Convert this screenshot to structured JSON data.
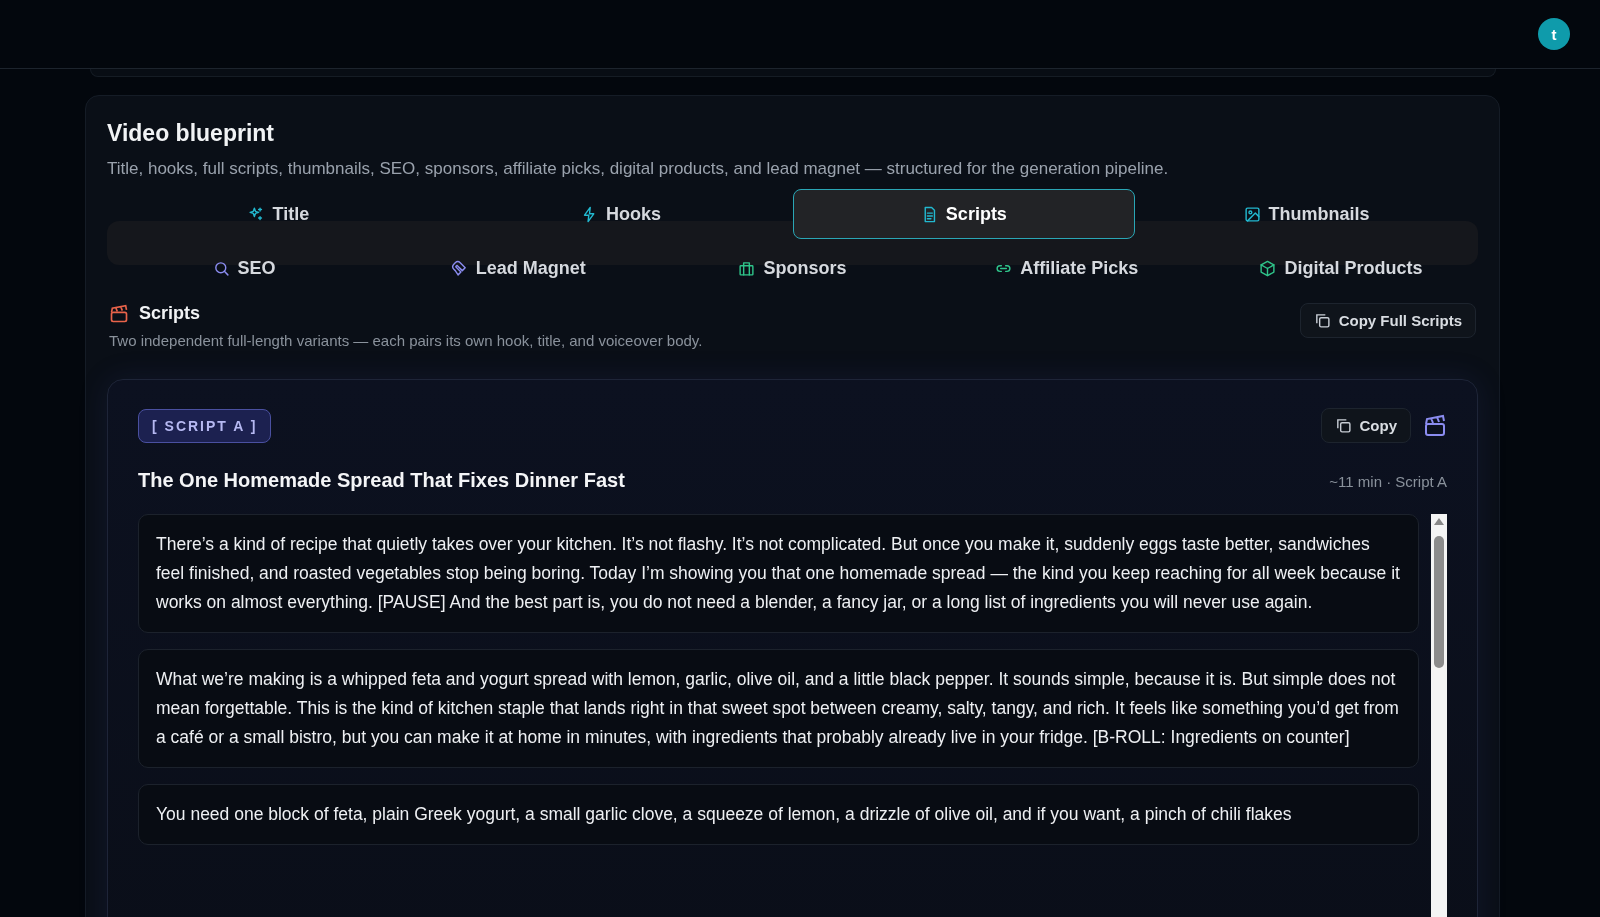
{
  "header": {
    "avatar": "t"
  },
  "blueprint": {
    "title": "Video blueprint",
    "subtitle": "Title, hooks, full scripts, thumbnails, SEO, sponsors, affiliate picks, digital products, and lead magnet — structured for the generation pipeline.",
    "tabs": [
      [
        {
          "label": "Title",
          "selected": false
        },
        {
          "label": "Hooks",
          "selected": false
        },
        {
          "label": "Scripts",
          "selected": true
        },
        {
          "label": "Thumbnails",
          "selected": false
        }
      ],
      [
        {
          "label": "SEO",
          "selected": false
        },
        {
          "label": "Lead Magnet",
          "selected": false
        },
        {
          "label": "Sponsors",
          "selected": false
        },
        {
          "label": "Affiliate Picks",
          "selected": false
        },
        {
          "label": "Digital Products",
          "selected": false
        }
      ]
    ]
  },
  "section": {
    "title": "Scripts",
    "subtitle": "Two independent full-length variants — each pairs its own hook, title, and voiceover body.",
    "copy_all": "Copy Full Scripts"
  },
  "script": {
    "badge": "[ SCRIPT A ]",
    "copy": "Copy",
    "title": "The One Homemade Spread That Fixes Dinner Fast",
    "meta": "~11 min · Script A",
    "paragraphs": [
      "There’s a kind of recipe that quietly takes over your kitchen. It’s not flashy. It’s not complicated. But once you make it, suddenly eggs taste better, sandwiches feel finished, and roasted vegetables stop being boring. Today I’m showing you that one homemade spread — the kind you keep reaching for all week because it works on almost everything. [PAUSE] And the best part is, you do not need a blender, a fancy jar, or a long list of ingredients you will never use again.",
      "What we’re making is a whipped feta and yogurt spread with lemon, garlic, olive oil, and a little black pepper. It sounds simple, because it is. But simple does not mean forgettable. This is the kind of kitchen staple that lands right in that sweet spot between creamy, salty, tangy, and rich. It feels like something you’d get from a café or a small bistro, but you can make it at home in minutes, with ingredients that probably already live in your fridge. [B-ROLL: Ingredients on counter]",
      "You need one block of feta, plain Greek yogurt, a small garlic clove, a squeeze of lemon, a drizzle of olive oil, and if you want, a pinch of chili flakes"
    ]
  }
}
